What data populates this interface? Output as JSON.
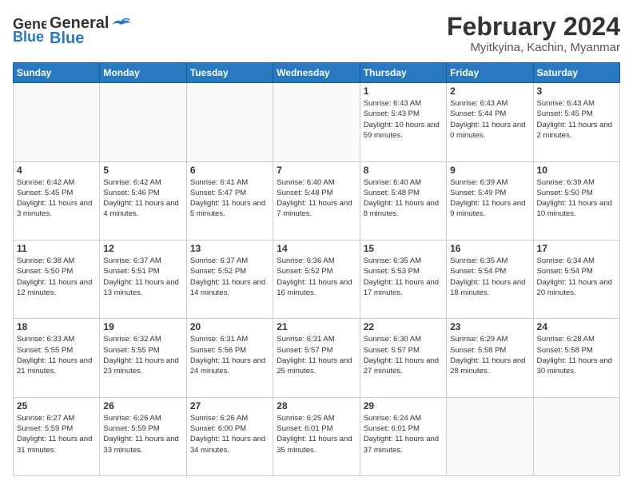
{
  "header": {
    "logo_general": "General",
    "logo_blue": "Blue",
    "month_year": "February 2024",
    "location": "Myitkyina, Kachin, Myanmar"
  },
  "weekdays": [
    "Sunday",
    "Monday",
    "Tuesday",
    "Wednesday",
    "Thursday",
    "Friday",
    "Saturday"
  ],
  "weeks": [
    [
      {
        "day": "",
        "info": ""
      },
      {
        "day": "",
        "info": ""
      },
      {
        "day": "",
        "info": ""
      },
      {
        "day": "",
        "info": ""
      },
      {
        "day": "1",
        "info": "Sunrise: 6:43 AM\nSunset: 5:43 PM\nDaylight: 10 hours\nand 59 minutes."
      },
      {
        "day": "2",
        "info": "Sunrise: 6:43 AM\nSunset: 5:44 PM\nDaylight: 11 hours\nand 0 minutes."
      },
      {
        "day": "3",
        "info": "Sunrise: 6:43 AM\nSunset: 5:45 PM\nDaylight: 11 hours\nand 2 minutes."
      }
    ],
    [
      {
        "day": "4",
        "info": "Sunrise: 6:42 AM\nSunset: 5:45 PM\nDaylight: 11 hours\nand 3 minutes."
      },
      {
        "day": "5",
        "info": "Sunrise: 6:42 AM\nSunset: 5:46 PM\nDaylight: 11 hours\nand 4 minutes."
      },
      {
        "day": "6",
        "info": "Sunrise: 6:41 AM\nSunset: 5:47 PM\nDaylight: 11 hours\nand 5 minutes."
      },
      {
        "day": "7",
        "info": "Sunrise: 6:40 AM\nSunset: 5:48 PM\nDaylight: 11 hours\nand 7 minutes."
      },
      {
        "day": "8",
        "info": "Sunrise: 6:40 AM\nSunset: 5:48 PM\nDaylight: 11 hours\nand 8 minutes."
      },
      {
        "day": "9",
        "info": "Sunrise: 6:39 AM\nSunset: 5:49 PM\nDaylight: 11 hours\nand 9 minutes."
      },
      {
        "day": "10",
        "info": "Sunrise: 6:39 AM\nSunset: 5:50 PM\nDaylight: 11 hours\nand 10 minutes."
      }
    ],
    [
      {
        "day": "11",
        "info": "Sunrise: 6:38 AM\nSunset: 5:50 PM\nDaylight: 11 hours\nand 12 minutes."
      },
      {
        "day": "12",
        "info": "Sunrise: 6:37 AM\nSunset: 5:51 PM\nDaylight: 11 hours\nand 13 minutes."
      },
      {
        "day": "13",
        "info": "Sunrise: 6:37 AM\nSunset: 5:52 PM\nDaylight: 11 hours\nand 14 minutes."
      },
      {
        "day": "14",
        "info": "Sunrise: 6:36 AM\nSunset: 5:52 PM\nDaylight: 11 hours\nand 16 minutes."
      },
      {
        "day": "15",
        "info": "Sunrise: 6:35 AM\nSunset: 5:53 PM\nDaylight: 11 hours\nand 17 minutes."
      },
      {
        "day": "16",
        "info": "Sunrise: 6:35 AM\nSunset: 5:54 PM\nDaylight: 11 hours\nand 18 minutes."
      },
      {
        "day": "17",
        "info": "Sunrise: 6:34 AM\nSunset: 5:54 PM\nDaylight: 11 hours\nand 20 minutes."
      }
    ],
    [
      {
        "day": "18",
        "info": "Sunrise: 6:33 AM\nSunset: 5:55 PM\nDaylight: 11 hours\nand 21 minutes."
      },
      {
        "day": "19",
        "info": "Sunrise: 6:32 AM\nSunset: 5:55 PM\nDaylight: 11 hours\nand 23 minutes."
      },
      {
        "day": "20",
        "info": "Sunrise: 6:31 AM\nSunset: 5:56 PM\nDaylight: 11 hours\nand 24 minutes."
      },
      {
        "day": "21",
        "info": "Sunrise: 6:31 AM\nSunset: 5:57 PM\nDaylight: 11 hours\nand 25 minutes."
      },
      {
        "day": "22",
        "info": "Sunrise: 6:30 AM\nSunset: 5:57 PM\nDaylight: 11 hours\nand 27 minutes."
      },
      {
        "day": "23",
        "info": "Sunrise: 6:29 AM\nSunset: 5:58 PM\nDaylight: 11 hours\nand 28 minutes."
      },
      {
        "day": "24",
        "info": "Sunrise: 6:28 AM\nSunset: 5:58 PM\nDaylight: 11 hours\nand 30 minutes."
      }
    ],
    [
      {
        "day": "25",
        "info": "Sunrise: 6:27 AM\nSunset: 5:59 PM\nDaylight: 11 hours\nand 31 minutes."
      },
      {
        "day": "26",
        "info": "Sunrise: 6:26 AM\nSunset: 5:59 PM\nDaylight: 11 hours\nand 33 minutes."
      },
      {
        "day": "27",
        "info": "Sunrise: 6:26 AM\nSunset: 6:00 PM\nDaylight: 11 hours\nand 34 minutes."
      },
      {
        "day": "28",
        "info": "Sunrise: 6:25 AM\nSunset: 6:01 PM\nDaylight: 11 hours\nand 35 minutes."
      },
      {
        "day": "29",
        "info": "Sunrise: 6:24 AM\nSunset: 6:01 PM\nDaylight: 11 hours\nand 37 minutes."
      },
      {
        "day": "",
        "info": ""
      },
      {
        "day": "",
        "info": ""
      }
    ]
  ]
}
